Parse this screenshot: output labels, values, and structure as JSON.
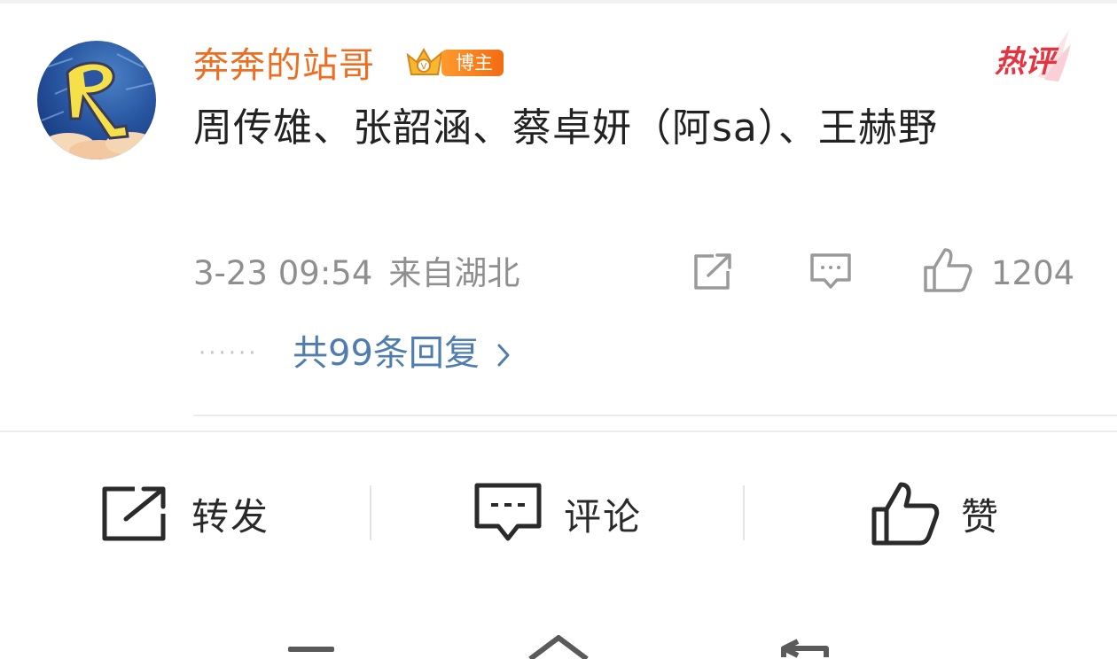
{
  "comment": {
    "username": "奔奔的站哥",
    "badge_label": "博主",
    "hot_label": "热评",
    "text": "周传雄、张韶涵、蔡卓妍（阿sa）、王赫野",
    "date": "3-23 09:54",
    "location": "来自湖北",
    "like_count": "1204",
    "dots": "······",
    "replies_label": "共99条回复"
  },
  "actions": {
    "share": "转发",
    "comment": "评论",
    "like": "赞"
  },
  "colors": {
    "username": "#ec6e22",
    "replies_link": "#507daf",
    "hot": "#e5333f",
    "meta": "#8f8f8f"
  },
  "icons": [
    "share-icon",
    "comment-icon",
    "like-icon",
    "chevron-right-icon",
    "crown-icon",
    "hot-wing-icon"
  ]
}
